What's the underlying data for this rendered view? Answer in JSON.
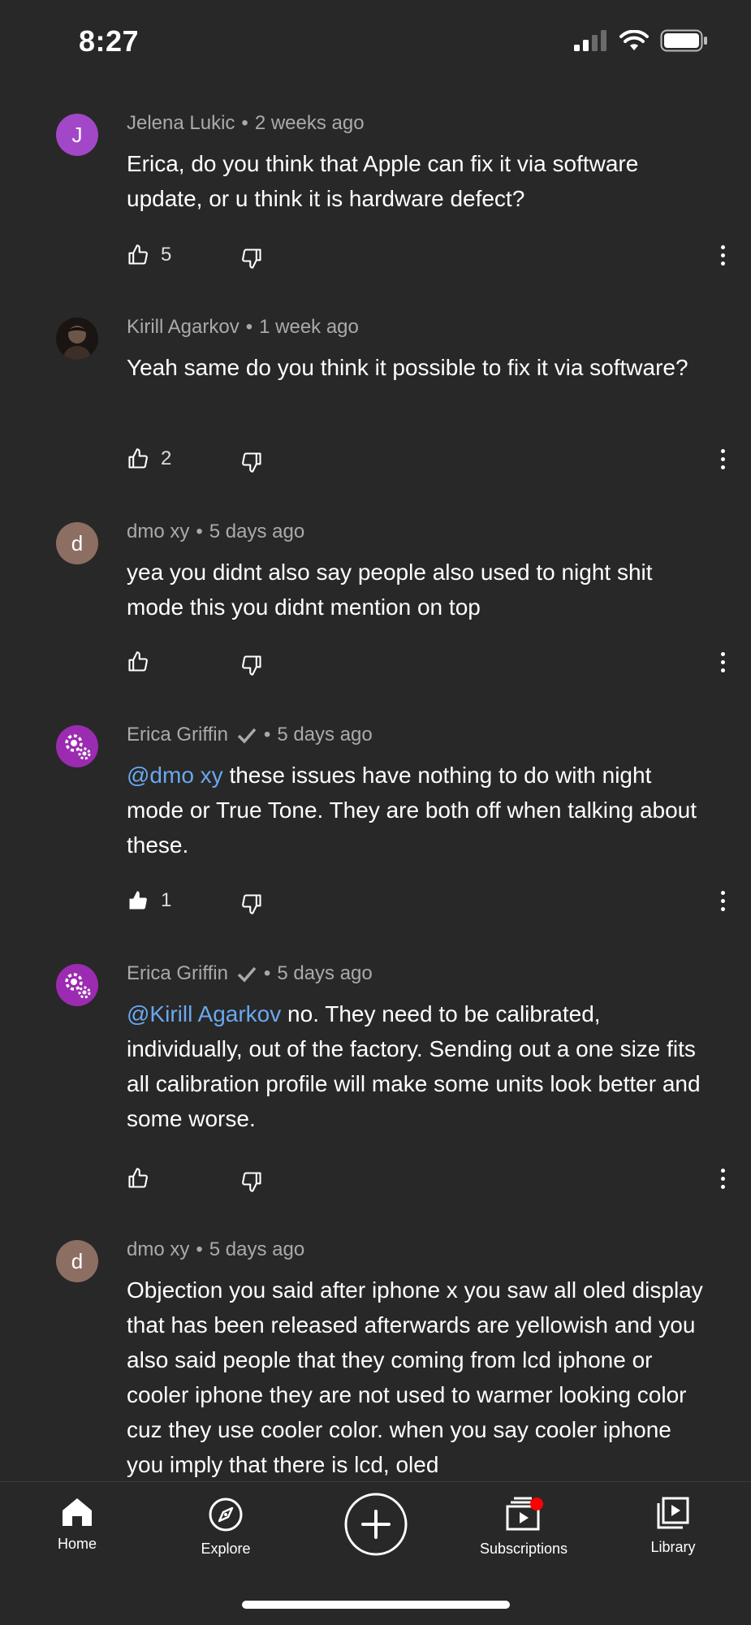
{
  "status_bar": {
    "time": "8:27"
  },
  "comments": [
    {
      "author": "Jelena Lukic",
      "age": "2 weeks ago",
      "avatar_letter": "J",
      "avatar_color": "#a247c8",
      "verified": false,
      "mention": "",
      "text": "Erica, do you think that Apple can fix it via software update, or u think it is hardware defect?",
      "likes": "5",
      "liked": false
    },
    {
      "author": "Kirill Agarkov",
      "age": "1 week ago",
      "avatar_letter": "",
      "avatar_color": "#2a2421",
      "verified": false,
      "mention": "",
      "text": "Yeah same do you think it possible to fix it via software?",
      "likes": "2",
      "liked": false
    },
    {
      "author": "dmo xy",
      "age": "5 days ago",
      "avatar_letter": "d",
      "avatar_color": "#8d6e63",
      "verified": false,
      "mention": "",
      "text": "yea you didnt also say people also used to night shit mode this you didnt mention on top",
      "likes": "",
      "liked": false
    },
    {
      "author": "Erica Griffin",
      "age": "5 days ago",
      "avatar_letter": "",
      "avatar_color": "#9b2bb0",
      "verified": true,
      "mention": "@dmo xy",
      "text": " these issues have nothing to do with night mode or True Tone. They are both off when talking about these.",
      "likes": "1",
      "liked": true
    },
    {
      "author": "Erica Griffin",
      "age": "5 days ago",
      "avatar_letter": "",
      "avatar_color": "#9b2bb0",
      "verified": true,
      "mention": "@Kirill Agarkov",
      "text": " no. They need to be calibrated, individually, out of the factory. Sending out a one size fits all calibration profile will make some units look better and some worse.",
      "likes": "",
      "liked": false
    },
    {
      "author": "dmo xy",
      "age": "5 days ago",
      "avatar_letter": "d",
      "avatar_color": "#8d6e63",
      "verified": false,
      "mention": "",
      "text": "Objection you said after iphone x you saw all oled display that has been released afterwards are yellowish and you also  said people that they coming from lcd iphone or cooler iphone they are not used to warmer looking color cuz they use cooler color. when you say cooler iphone you imply that there is lcd, oled",
      "likes": "",
      "liked": false
    }
  ],
  "bottom_nav": {
    "items": [
      {
        "label": "Home",
        "icon": "home-icon"
      },
      {
        "label": "Explore",
        "icon": "compass-icon"
      },
      {
        "label": "",
        "icon": "create-plus-icon"
      },
      {
        "label": "Subscriptions",
        "icon": "subscriptions-icon"
      },
      {
        "label": "Library",
        "icon": "library-icon"
      }
    ],
    "subscriptions_badge_color": "#ff0000"
  }
}
